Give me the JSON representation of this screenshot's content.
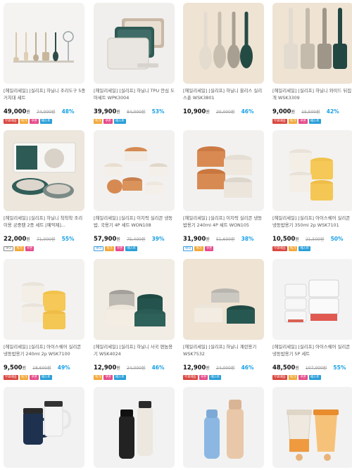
{
  "products": [
    {
      "title": "[헤일리세일] [실리프] 하닐니 조리도구 5종 거치대 세트",
      "price": "49,000",
      "won": "원",
      "original": "74,000원",
      "discount": "48%",
      "badges": [
        {
          "text": "무료배송",
          "color": "#d9473f"
        },
        {
          "text": "특가",
          "color": "#f2a93b"
        },
        {
          "text": "쿠폰",
          "color": "#e64b8b"
        },
        {
          "text": "베스트",
          "color": "#2a9fd8"
        }
      ]
    },
    {
      "title": "[헤일리세일] [실리프] 하닐니 TPU 안심 도마세트 WPK3004",
      "price": "39,900",
      "won": "원",
      "original": "84,000원",
      "discount": "53%",
      "badges": [
        {
          "text": "특가",
          "color": "#f2a93b"
        },
        {
          "text": "쿠폰",
          "color": "#e64b8b"
        },
        {
          "text": "베스트",
          "color": "#2a9fd8"
        }
      ]
    },
    {
      "title": "[헤일리세일] [실리프] 하닐니 올리스 실리스푼 WSK3801",
      "price": "10,900",
      "won": "원",
      "original": "20,000원",
      "discount": "46%",
      "badges": []
    },
    {
      "title": "[헤일리세일] [실리프] 하닐니 와이드 뒤집개 WSK3309",
      "price": "9,000",
      "won": "원",
      "original": "15,500원",
      "discount": "42%",
      "badges": [
        {
          "text": "무료배송",
          "color": "#d9473f"
        },
        {
          "text": "특가",
          "color": "#f2a93b"
        },
        {
          "text": "쿠폰",
          "color": "#e64b8b"
        },
        {
          "text": "베스트",
          "color": "#2a9fd8"
        }
      ]
    },
    {
      "title": "[헤일리세일] [실리프] 하닐니 착착착 조리이용 궁중팬 2종 세트 [예약제]...",
      "price": "22,000",
      "won": "원",
      "original": "71,000원",
      "discount": "55%",
      "badges": [
        {
          "text": "예약",
          "color": "#888888",
          "outline": true
        },
        {
          "text": "특가",
          "color": "#f2a93b"
        },
        {
          "text": "쿠폰",
          "color": "#e64b8b"
        }
      ]
    },
    {
      "title": "[헤일리세일] [실리프] 이지락 실리콘 냉동밥, 국용기 4P 세트 WON108",
      "price": "57,900",
      "won": "원",
      "original": "75,400원",
      "discount": "39%",
      "badges": [
        {
          "text": "예약",
          "color": "#3d9be0",
          "outline": true
        },
        {
          "text": "특가",
          "color": "#f2a93b"
        },
        {
          "text": "쿠폰",
          "color": "#e64b8b"
        },
        {
          "text": "베스트",
          "color": "#2a9fd8"
        }
      ]
    },
    {
      "title": "[헤일리세일] [실리프] 이지락 실리콘 냉동밥용기 240ml 4P 세트 WON105",
      "price": "31,900",
      "won": "원",
      "original": "51,600원",
      "discount": "38%",
      "badges": [
        {
          "text": "예약",
          "color": "#3d9be0",
          "outline": true
        },
        {
          "text": "특가",
          "color": "#f2a93b"
        },
        {
          "text": "쿠폰",
          "color": "#e64b8b"
        }
      ]
    },
    {
      "title": "[헤일리세일] [실리프] 아이스쉐어 실리콘 냉동밥용기 350ml 2p WSK7101",
      "price": "10,500",
      "won": "원",
      "original": "21,500원",
      "discount": "50%",
      "badges": [
        {
          "text": "무료배송",
          "color": "#d9473f"
        },
        {
          "text": "특가",
          "color": "#f2a93b"
        },
        {
          "text": "베스트",
          "color": "#2a9fd8"
        }
      ]
    },
    {
      "title": "[헤일리세일] [실리프] 아이스쉐어 실리콘 냉동밥용기 240ml 2p WSK7100",
      "price": "9,500",
      "won": "원",
      "original": "18,600원",
      "discount": "49%",
      "badges": [
        {
          "text": "무료배송",
          "color": "#d9473f"
        },
        {
          "text": "특가",
          "color": "#f2a93b"
        },
        {
          "text": "쿠폰",
          "color": "#e64b8b"
        },
        {
          "text": "베스트",
          "color": "#2a9fd8"
        }
      ]
    },
    {
      "title": "[헤일리세일] [실리프] 하닐니 사국 편놈용기 WSK4024",
      "price": "12,900",
      "won": "원",
      "original": "24,000원",
      "discount": "46%",
      "badges": [
        {
          "text": "특가",
          "color": "#f2a93b"
        },
        {
          "text": "쿠폰",
          "color": "#e64b8b"
        },
        {
          "text": "베스트",
          "color": "#2a9fd8"
        }
      ]
    },
    {
      "title": "[헤일리세일] [실리프] 하닐니 계란용기 WSK7532",
      "price": "12,900",
      "won": "원",
      "original": "24,000원",
      "discount": "46%",
      "badges": [
        {
          "text": "무료배송",
          "color": "#d9473f"
        },
        {
          "text": "쿠폰",
          "color": "#e64b8b"
        },
        {
          "text": "베스트",
          "color": "#2a9fd8"
        }
      ]
    },
    {
      "title": "[헤일리세일] [실리프] 아이스쉐어 실리콘 냉동밥용기 5P 세트",
      "price": "48,500",
      "won": "원",
      "original": "107,000원",
      "discount": "55%",
      "badges": [
        {
          "text": "무료배송",
          "color": "#d9473f"
        },
        {
          "text": "특가",
          "color": "#f2a93b"
        },
        {
          "text": "쿠폰",
          "color": "#e64b8b"
        },
        {
          "text": "베스트",
          "color": "#2a9fd8"
        }
      ]
    }
  ],
  "bottom_row": [
    {
      "image": "navy-white-tumblers"
    },
    {
      "image": "black-white-bottles"
    },
    {
      "image": "blue-beige-bottles"
    },
    {
      "image": "orange-shaker-bottles"
    }
  ]
}
